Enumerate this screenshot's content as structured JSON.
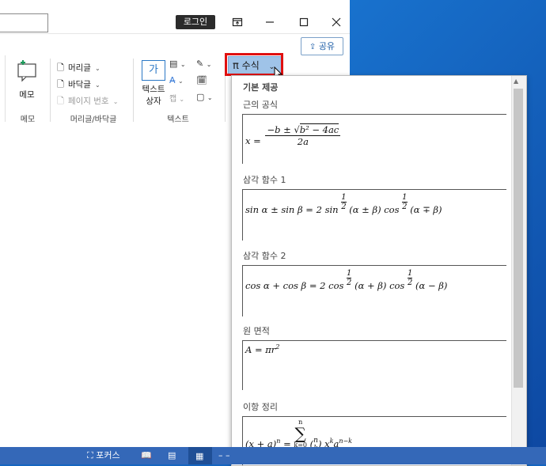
{
  "window": {
    "login_label": "로그인",
    "share_label": "공유"
  },
  "ribbon": {
    "memo_label": "메모",
    "header_label": "머리글",
    "footer_label": "바닥글",
    "page_number_label": "페이지 번호",
    "textbox_label_line1": "텍스트",
    "textbox_label_line2": "상자",
    "equation_label": "수식",
    "groups": {
      "memo": "메모",
      "header_footer": "머리글/바닥글",
      "text": "텍스트"
    }
  },
  "gallery": {
    "section_title": "기본 제공",
    "items": [
      {
        "label": "근의 공식",
        "equation": "x = (−b ± √(b² − 4ac)) / 2a"
      },
      {
        "label": "삼각 함수 1",
        "equation": "sin α ± sin β = 2 sin ½(α ± β) cos ½(α ∓ β)"
      },
      {
        "label": "삼각 함수 2",
        "equation": "cos α + cos β = 2 cos ½(α + β) cos ½(α − β)"
      },
      {
        "label": "원 면적",
        "equation": "A = πr²"
      },
      {
        "label": "이항 정리",
        "equation": "(x + a)ⁿ = Σ (n k) xᵏ aⁿ⁻ᵏ"
      }
    ]
  },
  "statusbar": {
    "focus_label": "포커스"
  },
  "colors": {
    "accent": "#3468b8",
    "highlight": "#e01010",
    "equation_button": "#9fc3e8"
  }
}
